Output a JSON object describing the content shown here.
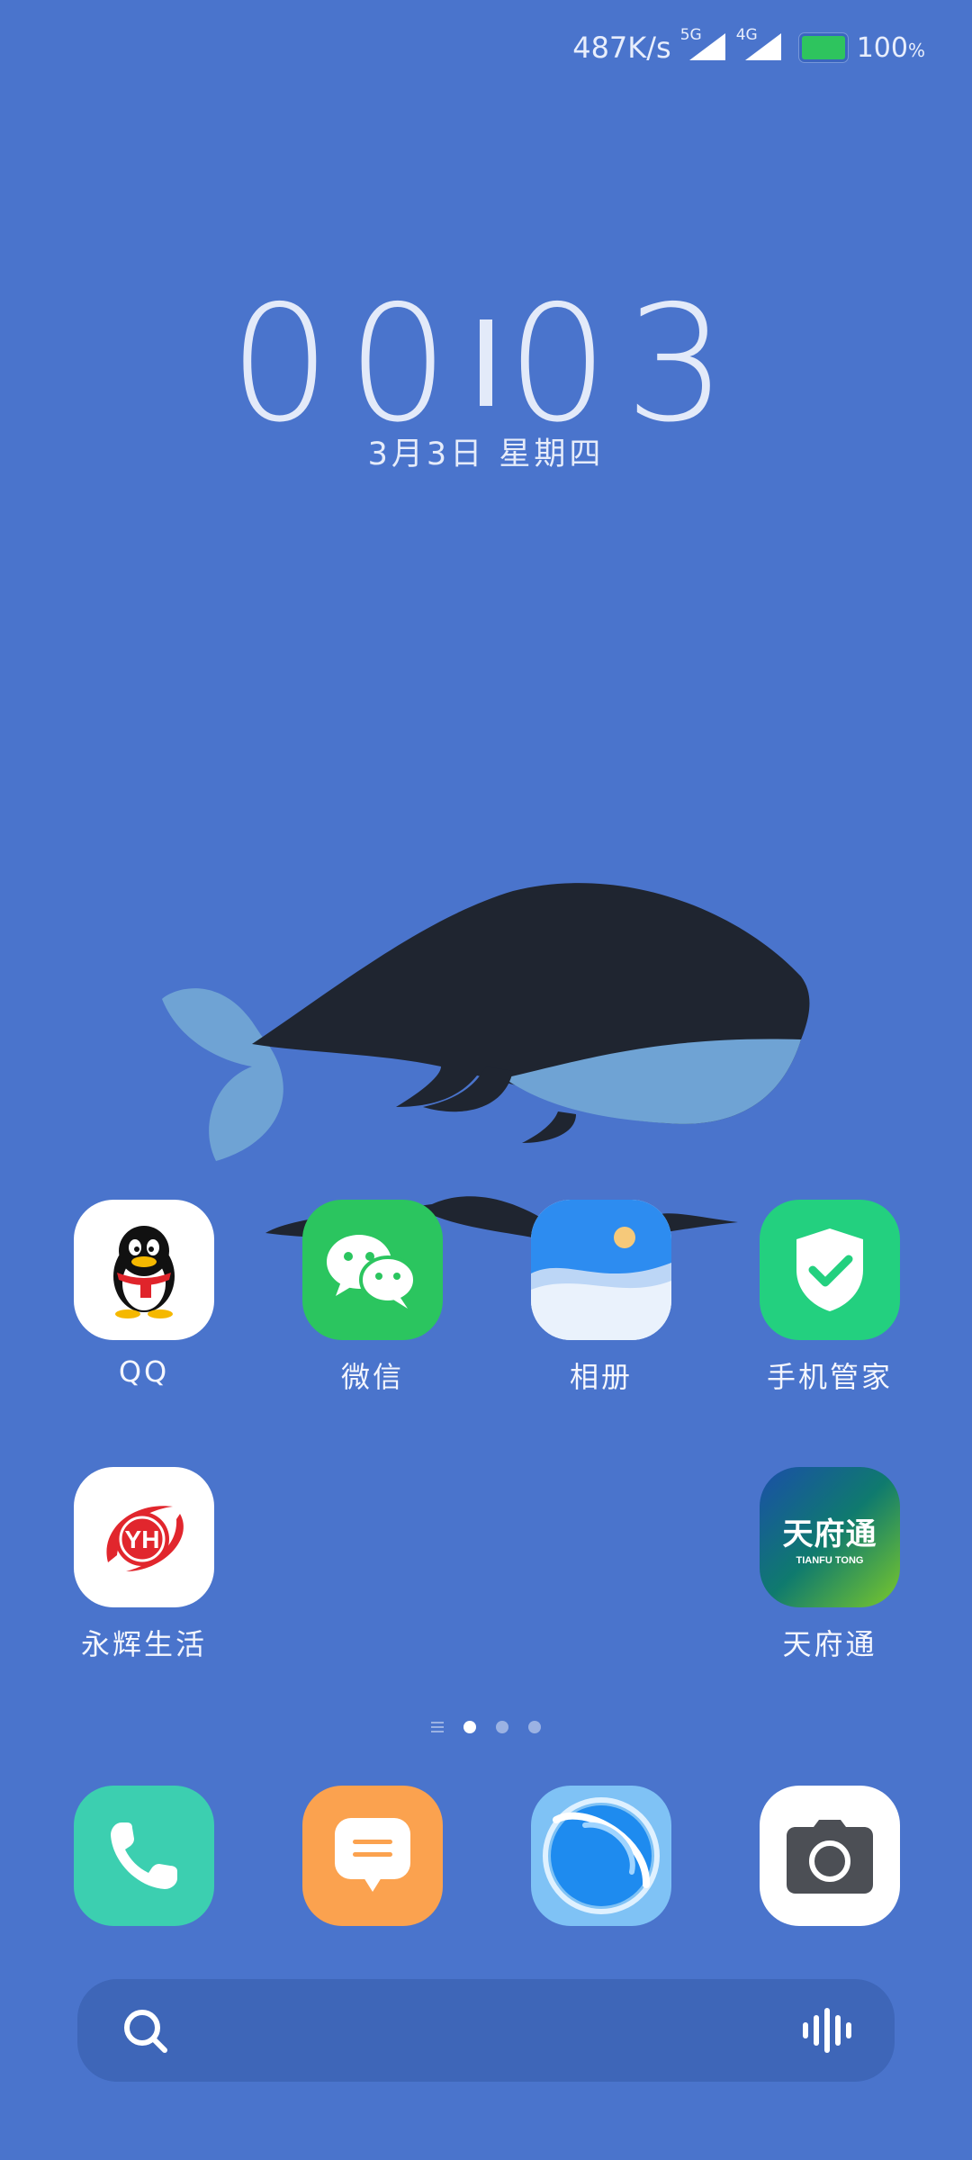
{
  "status_bar": {
    "net_speed": "487K/s",
    "signal1_label": "5G",
    "signal2_label": "4G",
    "battery_percent": "100",
    "battery_unit": "%",
    "battery_level": 1.0,
    "battery_color": "#2ec45e"
  },
  "clock": {
    "hours": "00",
    "minutes": "03",
    "date": "3月3日 星期四"
  },
  "apps": [
    {
      "label": "QQ",
      "icon": "qq-penguin-icon"
    },
    {
      "label": "微信",
      "icon": "wechat-icon"
    },
    {
      "label": "相册",
      "icon": "gallery-icon"
    },
    {
      "label": "手机管家",
      "icon": "phone-manager-shield-icon"
    },
    {
      "label": "永辉生活",
      "icon": "yonghui-life-icon"
    },
    {
      "label": "天府通",
      "icon": "tianfutong-icon",
      "logo_text": "天府通",
      "logo_subtext": "TIANFU TONG"
    }
  ],
  "page_indicator": {
    "pages": 3,
    "active_index": 0
  },
  "dock": [
    {
      "name": "phone",
      "icon": "phone-icon",
      "color": "#3ccfb0"
    },
    {
      "name": "messages",
      "icon": "messages-icon",
      "color": "#fba24f"
    },
    {
      "name": "browser",
      "icon": "browser-planet-icon",
      "color": "#5fb6f3"
    },
    {
      "name": "camera",
      "icon": "camera-icon",
      "color": "#ffffff"
    }
  ],
  "search": {
    "placeholder": "",
    "search_icon": "search-icon",
    "voice_icon": "voice-icon"
  },
  "colors": {
    "wallpaper": "#4a74cc",
    "whale_body": "#1f2530",
    "whale_belly": "#6fa3d4"
  }
}
